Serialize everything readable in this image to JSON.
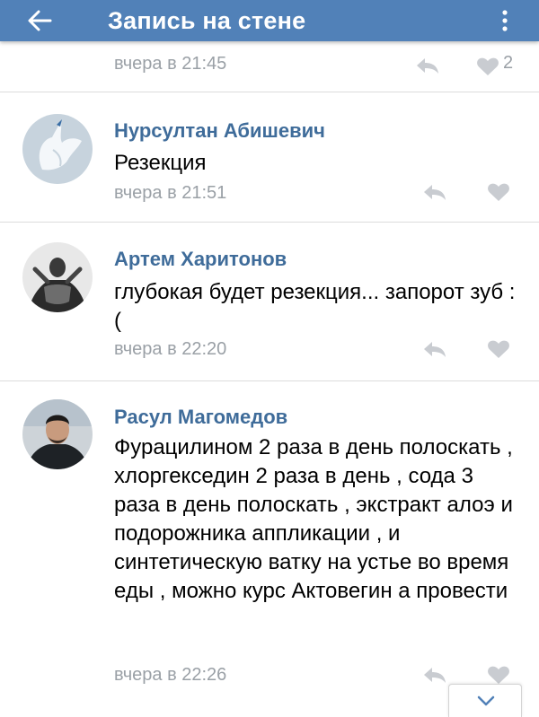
{
  "header": {
    "title": "Запись на стене",
    "icons": {
      "back": "arrow-left-icon",
      "more": "more-vert-icon"
    },
    "color": "#5181b8"
  },
  "partial_comment": {
    "time": "вчера в 21:45",
    "likes": "2"
  },
  "comments": [
    {
      "author": "Нурсултан Абишевич",
      "text": "Резекция",
      "time": "вчера в 21:51"
    },
    {
      "author": "Артем Харитонов",
      "text": "глубокая будет резекция... запорот зуб :(",
      "time": "вчера в 22:20"
    },
    {
      "author": "Расул Магомедов",
      "text": "Фурацилином 2 раза в день полоскать , хлоргекседин 2 раза в день , сода 3 раза в день полоскать , экстракт алоэ и подорожника аппликации , и синтетическую ватку на устье во время еды , можно курс Актовегин а провести",
      "time": "вчера в 22:26"
    }
  ],
  "colors": {
    "author": "#3f6c9a",
    "meta": "#9aa0a6",
    "divider": "#dcdcdc"
  },
  "icons": {
    "reply": "reply-icon",
    "like": "heart-icon",
    "scroll": "chevron-down-icon"
  }
}
